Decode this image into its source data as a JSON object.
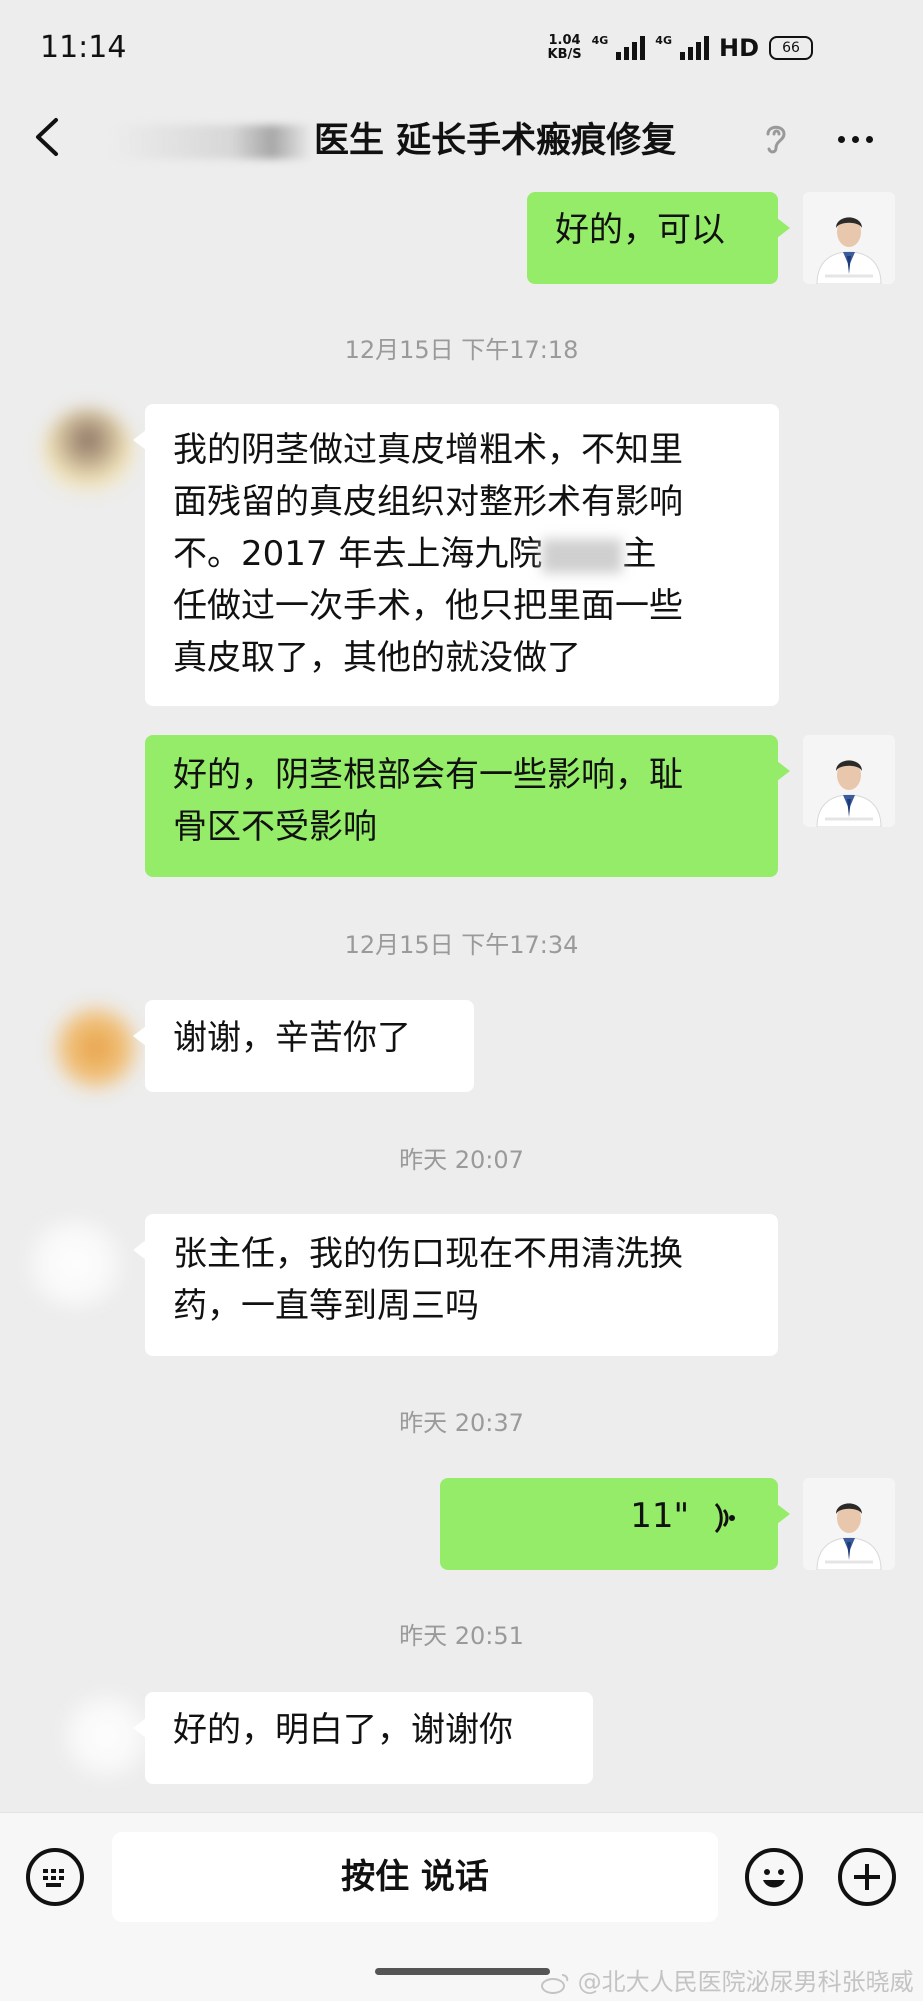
{
  "status_bar": {
    "time": "11:14",
    "speed_value": "1.04",
    "speed_unit": "KB/S",
    "network_1": "4G",
    "network_2": "4G",
    "hd": "HD",
    "battery": "66"
  },
  "header": {
    "title": "医生 延长手术瘢痕修复"
  },
  "messages": [
    {
      "side": "right",
      "text": "好的，可以"
    },
    {
      "side": "time",
      "text": "12月15日 下午17:18"
    },
    {
      "side": "left",
      "lines": [
        "我的阴茎做过真皮增粗术，不知里",
        "面残留的真皮组织对整形术有影响",
        "不。2017 年去上海九院",
        "任做过一次手术，他只把里面一些",
        "真皮取了，其他的就没做了"
      ],
      "line3_tail": "主"
    },
    {
      "side": "right",
      "lines": [
        "好的，阴茎根部会有一些影响，耻",
        "骨区不受影响"
      ]
    },
    {
      "side": "time",
      "text": "12月15日 下午17:34"
    },
    {
      "side": "left",
      "text": "谢谢，辛苦你了"
    },
    {
      "side": "time",
      "text": "昨天 20:07"
    },
    {
      "side": "left",
      "lines": [
        "张主任，我的伤口现在不用清洗换",
        "药，一直等到周三吗"
      ]
    },
    {
      "side": "time",
      "text": "昨天 20:37"
    },
    {
      "side": "right",
      "voice_duration": "11\""
    },
    {
      "side": "time",
      "text": "昨天 20:51"
    },
    {
      "side": "left",
      "text": "好的，明白了，谢谢你"
    }
  ],
  "input_bar": {
    "hold_to_talk_label": "按住 说话"
  },
  "watermark": "@北大人民医院泌尿男科张晓威",
  "colors": {
    "background": "#ededed",
    "sent_bubble": "#95ec69",
    "received_bubble": "#ffffff",
    "timestamp_text": "#9a9a9a"
  },
  "icons": [
    "back-chevron-icon",
    "ear-icon",
    "more-dots-icon",
    "keyboard-icon",
    "emoji-icon",
    "plus-icon",
    "voice-wave-icon",
    "weibo-icon"
  ]
}
